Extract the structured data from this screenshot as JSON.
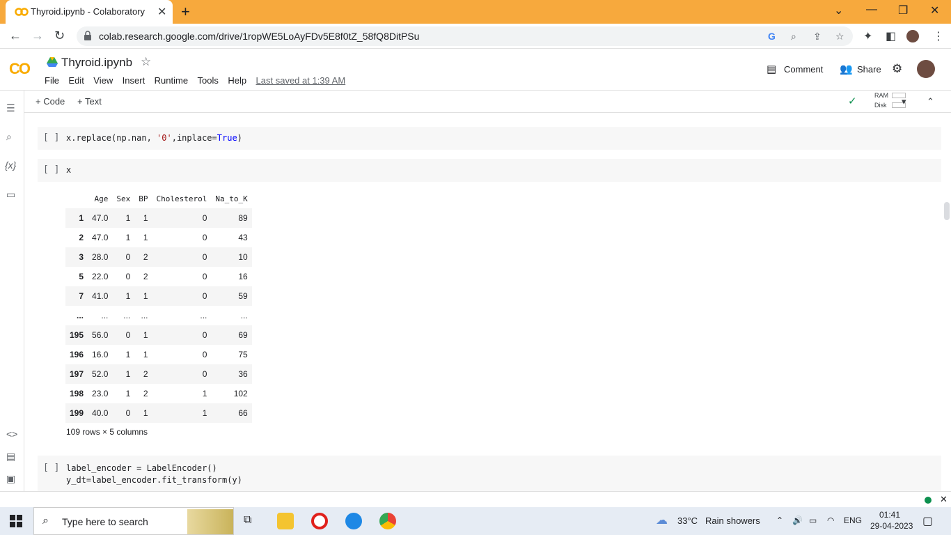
{
  "browser": {
    "tab_title": "Thyroid.ipynb - Colaboratory",
    "url": "colab.research.google.com/drive/1ropWE5LoAyFDv5E8f0tZ_58fQ8DitPSu"
  },
  "colab": {
    "filename": "Thyroid.ipynb",
    "menu": [
      "File",
      "Edit",
      "View",
      "Insert",
      "Runtime",
      "Tools",
      "Help"
    ],
    "last_saved": "Last saved at 1:39 AM",
    "comment_label": "Comment",
    "share_label": "Share",
    "add_code": "+ Code",
    "add_text": "+ Text",
    "ram_label": "RAM",
    "disk_label": "Disk"
  },
  "cells": {
    "c1_bracket": "[ ]",
    "c1_code_a": "x.replace(np.nan, ",
    "c1_code_str": "'0'",
    "c1_code_b": ",inplace=",
    "c1_code_true": "True",
    "c1_code_c": ")",
    "c2_bracket": "[ ]",
    "c2_code": "x",
    "c3_bracket": "[ ]",
    "c3_line1": "label_encoder = LabelEncoder()",
    "c3_line2": "y_dt=label_encoder.fit_transform(y)"
  },
  "dataframe": {
    "columns": [
      "",
      "Age",
      "Sex",
      "BP",
      "Cholesterol",
      "Na_to_K"
    ],
    "rows": [
      [
        "1",
        "47.0",
        "1",
        "1",
        "0",
        "89"
      ],
      [
        "2",
        "47.0",
        "1",
        "1",
        "0",
        "43"
      ],
      [
        "3",
        "28.0",
        "0",
        "2",
        "0",
        "10"
      ],
      [
        "5",
        "22.0",
        "0",
        "2",
        "0",
        "16"
      ],
      [
        "7",
        "41.0",
        "1",
        "1",
        "0",
        "59"
      ],
      [
        "...",
        "...",
        "...",
        "...",
        "...",
        "..."
      ],
      [
        "195",
        "56.0",
        "0",
        "1",
        "0",
        "69"
      ],
      [
        "196",
        "16.0",
        "1",
        "1",
        "0",
        "75"
      ],
      [
        "197",
        "52.0",
        "1",
        "2",
        "0",
        "36"
      ],
      [
        "198",
        "23.0",
        "1",
        "2",
        "1",
        "102"
      ],
      [
        "199",
        "40.0",
        "0",
        "1",
        "1",
        "66"
      ]
    ],
    "footer": "109 rows × 5 columns"
  },
  "taskbar": {
    "search_placeholder": "Type here to search",
    "temperature": "33°C",
    "weather": "Rain showers",
    "lang": "ENG",
    "time": "01:41",
    "date": "29-04-2023"
  }
}
